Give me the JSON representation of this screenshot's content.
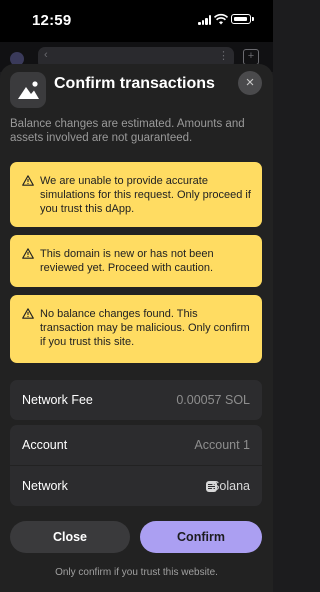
{
  "status_bar": {
    "time": "12:59"
  },
  "sheet": {
    "title": "Confirm transactions",
    "close_icon": "×",
    "subtitle": "Balance changes are estimated. Amounts and assets involved are not guaranteed."
  },
  "warnings": [
    {
      "text": "We are unable to provide accurate simulations for this request. Only proceed if you trust this dApp."
    },
    {
      "text": "This domain is new or has not been reviewed yet. Proceed with caution."
    },
    {
      "text": "No balance changes found. This transaction may be malicious. Only confirm if you trust this site."
    }
  ],
  "details": {
    "network_fee_label": "Network Fee",
    "network_fee_value": "0.00057 SOL",
    "account_label": "Account",
    "account_value": "Account 1",
    "network_label": "Network",
    "network_value": "Solana"
  },
  "actions": {
    "close_label": "Close",
    "confirm_label": "Confirm"
  },
  "footer": "Only confirm if you trust this website.",
  "colors": {
    "warning_bg": "#ffdc62",
    "confirm_bg": "#ab9ff2",
    "sheet_bg": "#222222"
  },
  "icons": [
    "warning-icon",
    "close-icon",
    "solana-icon",
    "app-logo-icon",
    "wifi-icon",
    "battery-icon",
    "signal-icon"
  ]
}
